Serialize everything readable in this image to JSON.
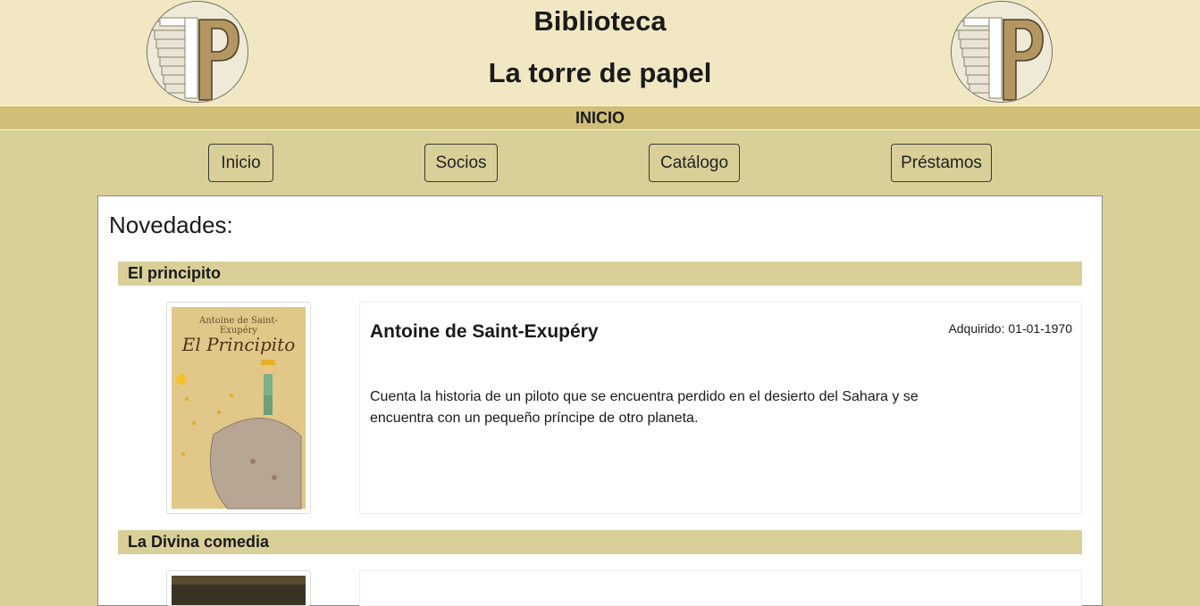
{
  "header": {
    "title_line1": "Biblioteca",
    "title_line2": "La torre de papel",
    "logo_icon": "tower-of-books-P-logo"
  },
  "section": {
    "label": "INICIO"
  },
  "nav": {
    "items": [
      {
        "label": "Inicio"
      },
      {
        "label": "Socios"
      },
      {
        "label": "Catálogo"
      },
      {
        "label": "Préstamos"
      }
    ]
  },
  "main": {
    "heading": "Novedades:",
    "books": [
      {
        "title": "El principito",
        "cover_title": "El Principito",
        "cover_author": "Antoine de Saint-Exupéry",
        "author": "Antoine de Saint-Exupéry",
        "acquired_label": "Adquirido:",
        "acquired_date": "01-01-1970",
        "description": "Cuenta la historia de un piloto que se encuentra perdido en el desierto del Sahara y se encuentra con un pequeño príncipe de otro planeta."
      },
      {
        "title": "La Divina comedia"
      }
    ]
  },
  "colors": {
    "header_bg": "#f1e8c3",
    "section_bar": "#d1bf78",
    "page_bg": "#d9cf98",
    "panel_bg": "#ffffff"
  }
}
